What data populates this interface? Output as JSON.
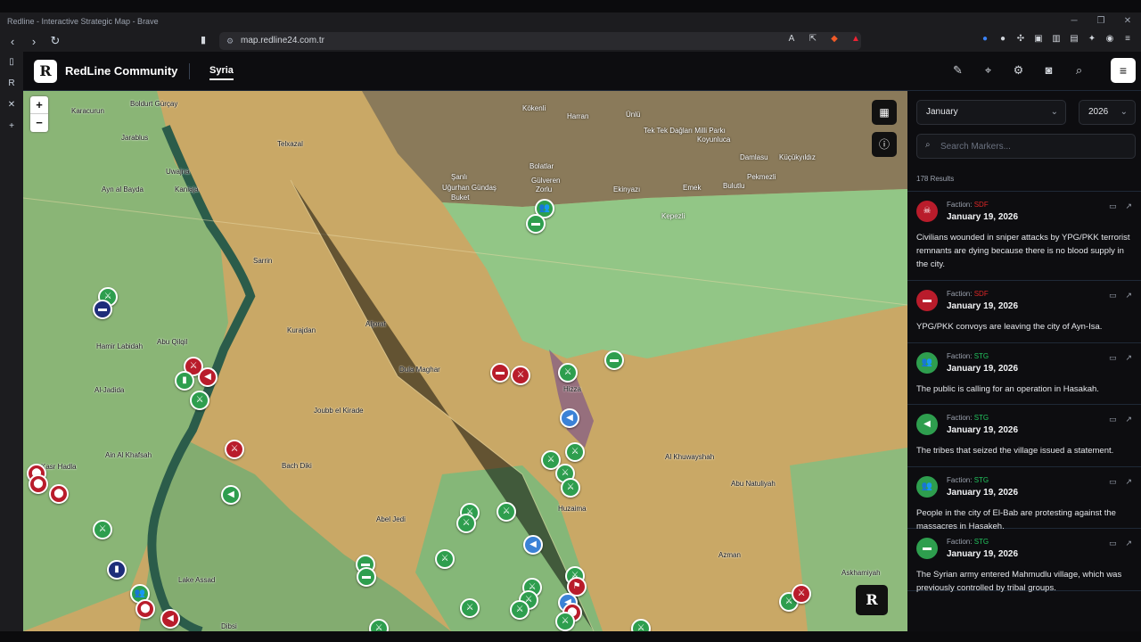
{
  "window": {
    "title": "Redline - Interactive Strategic Map - Brave"
  },
  "browser": {
    "url": "map.redline24.com.tr"
  },
  "app": {
    "logo": "R",
    "brand": "RedLine Community",
    "tab": "Syria"
  },
  "controls": {
    "zoom_in": "+",
    "zoom_out": "−",
    "float_logo": "R"
  },
  "panel": {
    "month": "January",
    "year": "2026",
    "search_placeholder": "Search Markers...",
    "results": "178 Results",
    "faction_label": "Faction:",
    "items": [
      {
        "faction": "SDF",
        "date": "January 19, 2026",
        "text": "Civilians wounded in sniper attacks by YPG/PKK terrorist remnants are dying because there is no blood supply in the city.",
        "color": "#dc2626",
        "icon": "skull-icon"
      },
      {
        "faction": "SDF",
        "date": "January 19, 2026",
        "text": "YPG/PKK convoys are leaving the city of Ayn-Isa.",
        "color": "#dc2626",
        "icon": "truck-icon"
      },
      {
        "faction": "STG",
        "date": "January 19, 2026",
        "text": "The public is calling for an operation in Hasakah.",
        "color": "#22c55e",
        "icon": "crowd-icon"
      },
      {
        "faction": "STG",
        "date": "January 19, 2026",
        "text": "The tribes that seized the village issued a statement.",
        "color": "#22c55e",
        "icon": "megaphone-icon"
      },
      {
        "faction": "STG",
        "date": "January 19, 2026",
        "text": "People in the city of El-Bab are protesting against the massacres in Hasakeh.",
        "color": "#22c55e",
        "icon": "crowd-icon"
      },
      {
        "faction": "STG",
        "date": "January 19, 2026",
        "text": "The Syrian army entered Mahmudlu village, which was previously controlled by tribal groups.",
        "color": "#22c55e",
        "icon": "truck-icon"
      }
    ]
  },
  "map": {
    "labels": [
      "Karacurun",
      "Boldurt Gürçay",
      "Kökenli",
      "Harran",
      "Ünlü",
      "Akçakale",
      "Ceylanpınar",
      "Bolatlar",
      "Gülveren",
      "Zorlu",
      "Akçakale",
      "Şanlı",
      "Uğurhan Gündaş",
      "Buket",
      "Ekinyazı",
      "Emek",
      "Kepezli",
      "Bulutlu",
      "Pekmezli",
      "Damlasu",
      "Koyunluca",
      "Küçükyıldız",
      "Tek Tek Dağları Milli Parkı",
      "Jarablus",
      "Ayn al Bayda",
      "Uwajna",
      "Kaniaja",
      "Telxazal",
      "Sarrin",
      "Abu Qilqil",
      "Hamir Labidah",
      "Al-Jadida",
      "Al Kashkan",
      "Ain Al Khafsah",
      "Kasr Hadla",
      "Bach Diki",
      "Kurajdan",
      "Aljorat",
      "Dula Maghar",
      "Joubb el Kirade",
      "Abel Jedi",
      "Al Bajarah",
      "Lake Assad",
      "Dibsi",
      "Al Khuwayshah",
      "Abu Natuliyah",
      "Azman",
      "Askhamiyah",
      "Huzaima",
      "Hizza",
      "Hizzat"
    ],
    "legend_colors": {
      "green": "#2e9e4e",
      "red": "#b91c2b",
      "blue": "#3b82d6",
      "navy": "#1e2d7a"
    }
  }
}
